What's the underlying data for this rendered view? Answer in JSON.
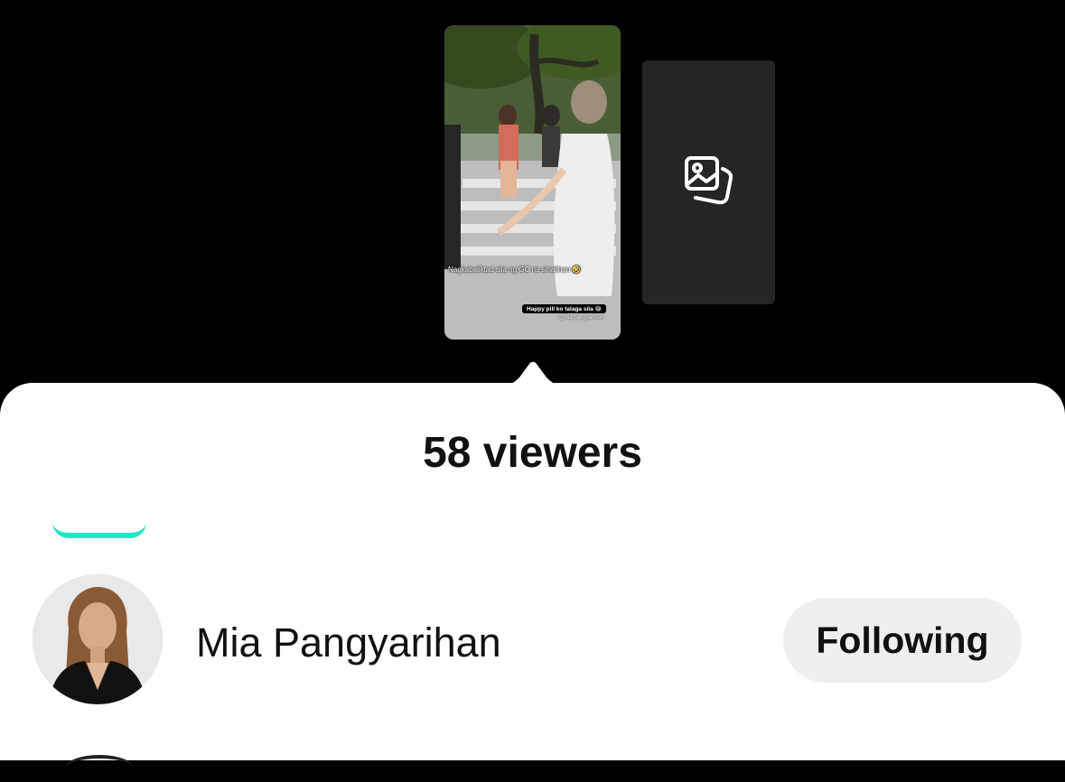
{
  "story": {
    "overlay_caption": "Nagkabaliktad sila ng GC na sinalihan 🤣",
    "overlay_sticker": "Happy pill ko talaga sila 😂",
    "overlay_handle": "@mia.pangyarihan",
    "add_icon": "photo-gallery-icon"
  },
  "viewers_sheet": {
    "title": "58 viewers",
    "accent_color": "#21e7c5",
    "viewers": [
      {
        "name": "Mia Pangyarihan",
        "button_label": "Following"
      }
    ]
  }
}
